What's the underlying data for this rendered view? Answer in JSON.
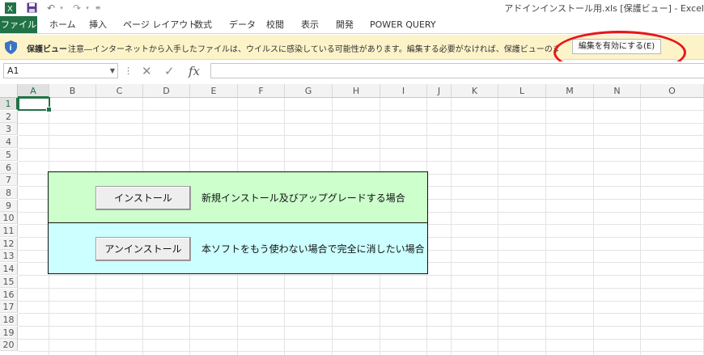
{
  "window": {
    "title": "アドインインストール用.xls [保護ビュー] - Excel"
  },
  "quick_access": [
    {
      "icon": "save-icon"
    },
    {
      "icon": "undo-icon"
    },
    {
      "icon": "redo-icon"
    },
    {
      "icon": "customize-icon"
    }
  ],
  "ribbon": {
    "tabs": [
      "ファイル",
      "ホーム",
      "挿入",
      "ページ レイアウト",
      "数式",
      "データ",
      "校閲",
      "表示",
      "開発",
      "POWER QUERY"
    ]
  },
  "protected_view": {
    "label": "保護ビュー",
    "message": "注意―インターネットから入手したファイルは、ウイルスに感染している可能性があります。編集する必要がなければ、保護ビューのままにしておくことをお勧めします。",
    "enable_button": "編集を有効にする(E)",
    "highlight_color": "#e8161c"
  },
  "formula_bar": {
    "name_box": "A1",
    "name_box_menu": "⋮",
    "cancel_glyph": "✕",
    "enter_glyph": "✓",
    "fx_label": "fx",
    "formula": ""
  },
  "sheet": {
    "columns": [
      "A",
      "B",
      "C",
      "D",
      "E",
      "F",
      "G",
      "H",
      "I",
      "J",
      "K",
      "L",
      "M",
      "N",
      "O"
    ],
    "rows": [
      "1",
      "2",
      "3",
      "4",
      "5",
      "6",
      "7",
      "8",
      "9",
      "10",
      "11",
      "12",
      "13",
      "14",
      "15",
      "16",
      "17",
      "18",
      "19",
      "20"
    ],
    "active_cell": "A1",
    "accent": "#217346"
  },
  "panel": {
    "install": {
      "button": "インストール",
      "description": "新規インストール及びアップグレードする場合",
      "color": "#ccffcc"
    },
    "uninstall": {
      "button": "アンインストール",
      "description": "本ソフトをもう使わない場合で完全に消したい場合",
      "color": "#ccffff"
    }
  }
}
